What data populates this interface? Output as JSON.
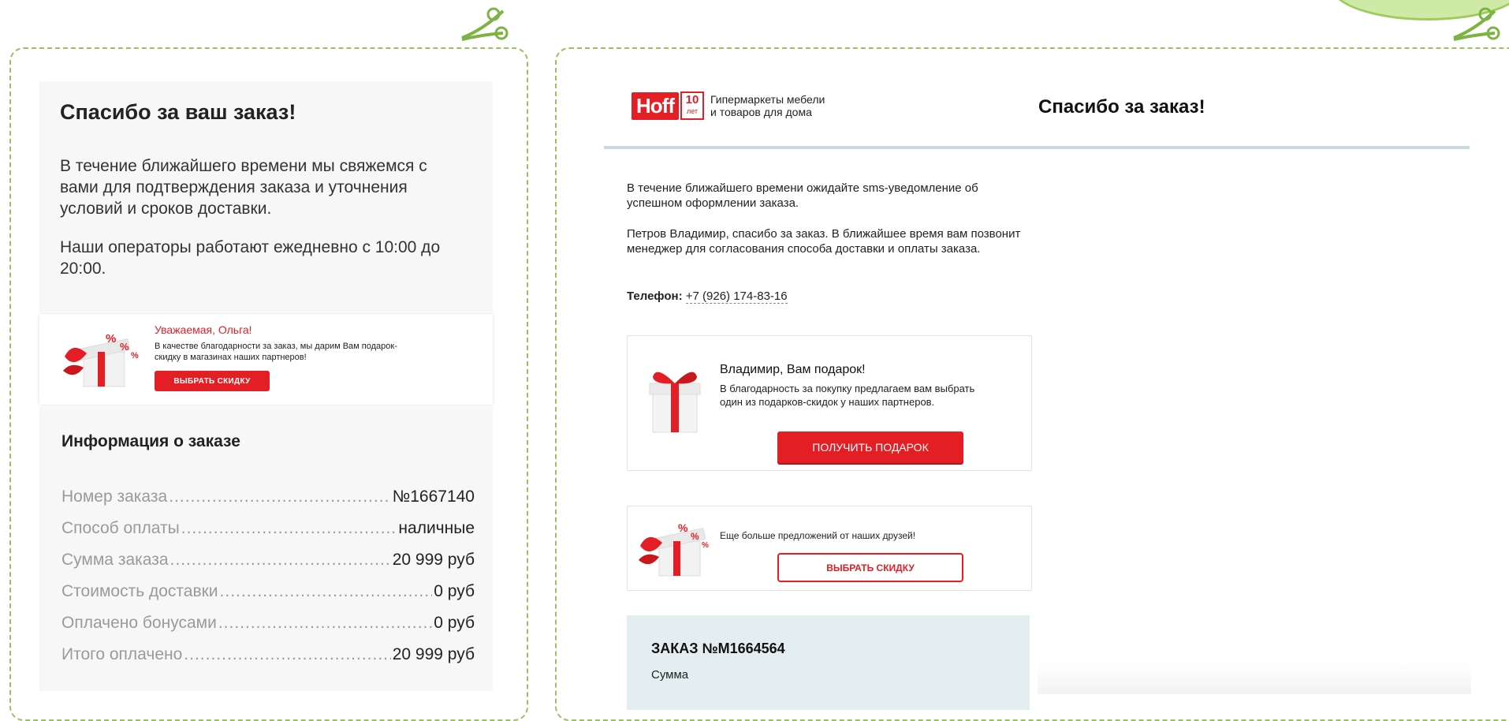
{
  "left": {
    "title": "Спасибо за ваш заказ!",
    "paragraph1": "В течение ближайшего времени мы свяжемся с вами для подтверждения заказа и уточнения условий и сроков доставки.",
    "paragraph2": " Наши операторы работают ежедневно с 10:00 до 20:00.",
    "banner": {
      "title": "Уважаемая, Ольга!",
      "text": "В качестве благодарности за заказ, мы дарим Вам подарок-скидку в магазинах наших партнеров!",
      "button": "ВЫБРАТЬ СКИДКУ"
    },
    "info": {
      "title": "Информация о заказе",
      "rows": [
        {
          "label": "Номер заказа",
          "value": "№1667140"
        },
        {
          "label": "Способ оплаты",
          "value": "наличные"
        },
        {
          "label": "Сумма заказа",
          "value": "20 999 руб"
        },
        {
          "label": "Стоимость доставки",
          "value": "0 руб"
        },
        {
          "label": "Оплачено бонусами",
          "value": "0 руб"
        },
        {
          "label": "Итого оплачено",
          "value": "20 999 руб"
        }
      ]
    }
  },
  "right": {
    "logo": {
      "brand": "Hoff",
      "years_number": "10",
      "years_word": "лет",
      "tagline_line1": "Гипермаркеты мебели",
      "tagline_line2": "и товаров для дома"
    },
    "title": "Спасибо за заказ!",
    "sms_text": "В течение ближайшего времени ожидайте sms-уведомление об успешном оформлении заказа.",
    "thanks_text": "Петров Владимир, спасибо за заказ. В ближайшее время вам позвонит менеджер для согласования способа доставки и оплаты заказа.",
    "phone_label": "Телефон:",
    "phone_value": "+7 (926) 174-83-16",
    "gift": {
      "title": "Владимир, Вам подарок!",
      "text": "В благодарность за покупку предлагаем вам выбрать один из подарков-скидок у наших партнеров.",
      "button": "ПОЛУЧИТЬ ПОДАРОК"
    },
    "offer": {
      "text": "Еще больше предложений от наших друзей!",
      "button": "ВЫБРАТЬ СКИДКУ"
    },
    "order": {
      "title": "ЗАКАЗ №М1664564",
      "sum_label": "Сумма"
    }
  },
  "colors": {
    "accent_red": "#e31e24",
    "frame_green": "#9cbf63",
    "order_box": "#e2eef0",
    "header_line": "#c7dbe3"
  },
  "icons": [
    "scissors-icon",
    "gift-box-icon"
  ]
}
